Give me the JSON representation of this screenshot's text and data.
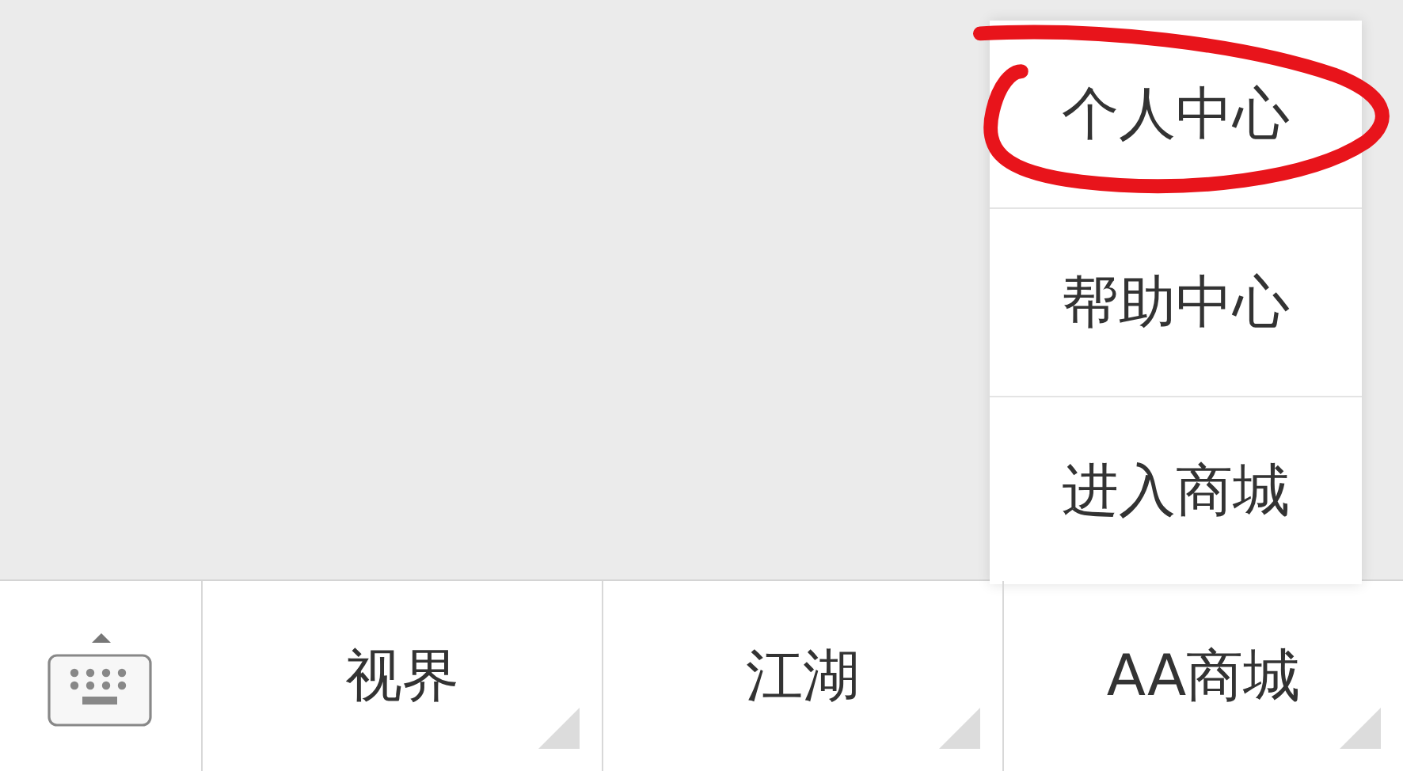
{
  "popup_menu": {
    "items": [
      {
        "label": "个人中心",
        "highlighted": true
      },
      {
        "label": "帮助中心",
        "highlighted": false
      },
      {
        "label": "进入商城",
        "highlighted": false
      }
    ]
  },
  "menu_bar": {
    "items": [
      {
        "label": "视界",
        "has_submenu": true
      },
      {
        "label": "江湖",
        "has_submenu": true
      },
      {
        "label": "AA商城",
        "has_submenu": true
      }
    ]
  }
}
